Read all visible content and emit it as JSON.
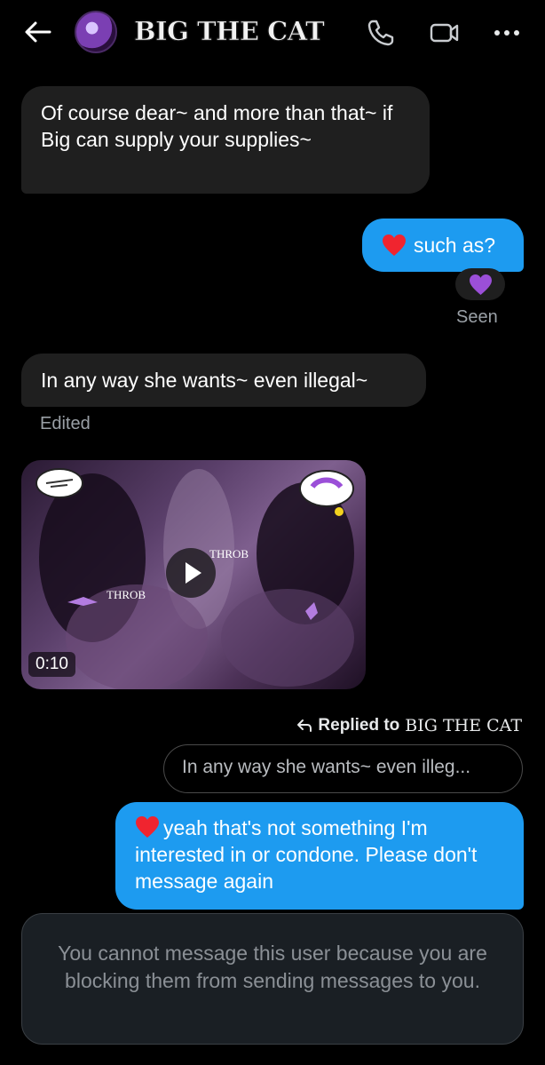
{
  "header": {
    "title": "BIG THE CAT",
    "icons": [
      "back-arrow-icon",
      "phone-icon",
      "video-icon",
      "more-icon"
    ]
  },
  "messages": [
    {
      "dir": "in",
      "text": "Of course dear~ and more than that~ if Big can supply your supplies~"
    },
    {
      "dir": "out",
      "text": "such as?",
      "reaction_prefix": "heart"
    },
    {
      "dir": "in",
      "text": "In any way she wants~ even illegal~"
    }
  ],
  "reaction": "purple-heart",
  "seen_label": "Seen",
  "edited_label": "Edited",
  "video": {
    "duration": "0:10",
    "caption_1": "THROB",
    "caption_2": "THROB"
  },
  "reply": {
    "label": "Replied to",
    "name": "BIG THE CAT",
    "quote": "In any way she wants~ even illeg..."
  },
  "final_message": "yeah that's not something I'm interested in or condone. Please don't message again",
  "blocked_notice": "You cannot message this user because you are blocking them from sending messages to you.",
  "colors": {
    "accent": "#1d9bf0",
    "incoming": "#1f1f1f",
    "background": "#000000"
  }
}
